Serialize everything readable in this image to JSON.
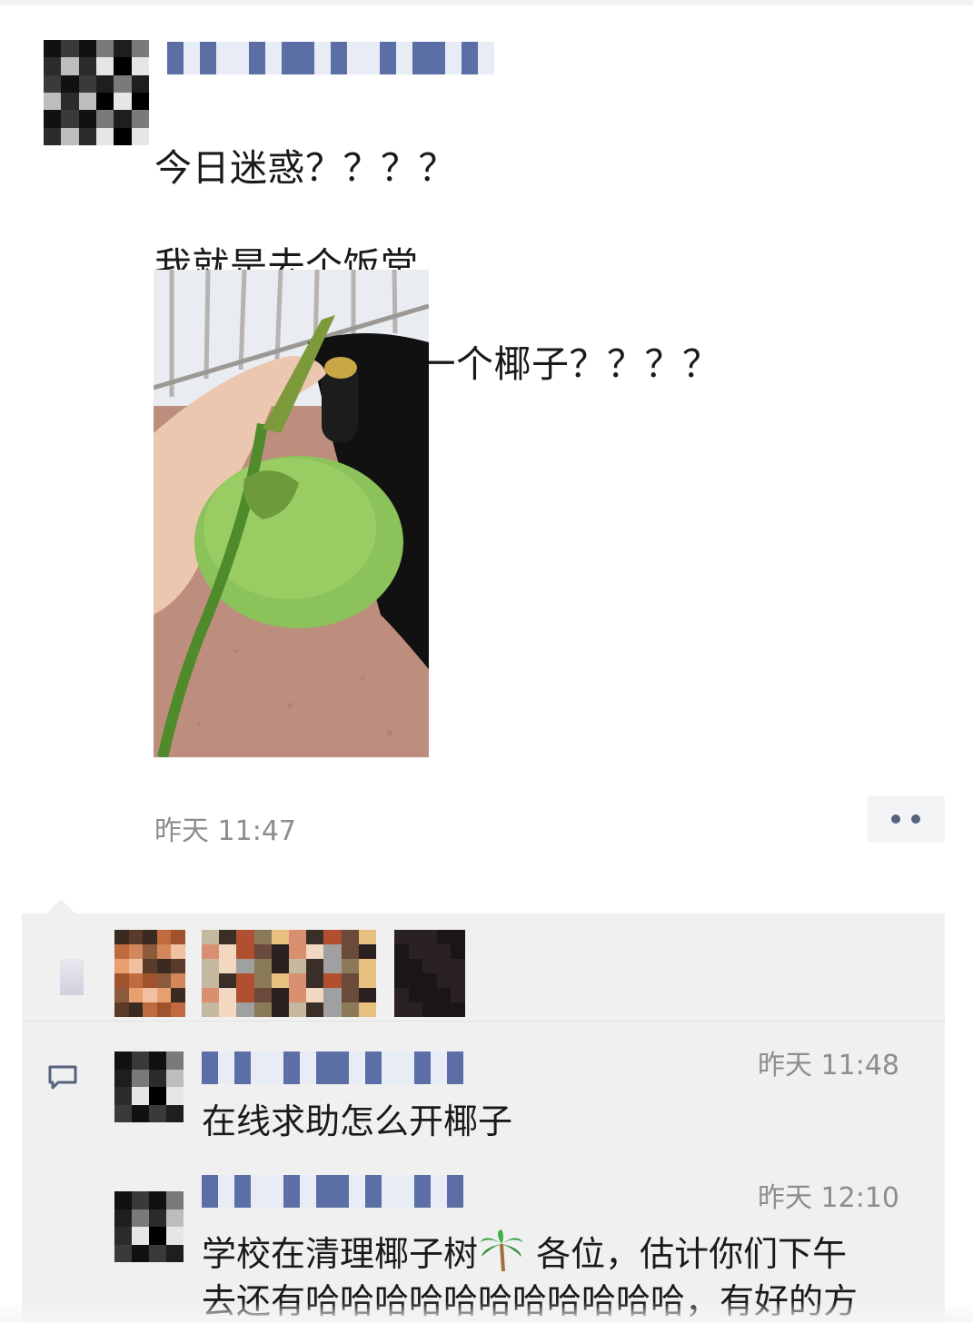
{
  "post": {
    "text_lines": [
      "今日迷惑？？？？",
      "我就是去个饭堂",
      "阿姨顺手塞给我一个椰子？？？？"
    ],
    "photo_icon": "coconut-photo",
    "timestamp": "昨天 11:47",
    "more_icon": "more-dots-icon"
  },
  "likes": {
    "icon": "heart-icon",
    "count_avatars": 3
  },
  "comments": [
    {
      "time": "昨天 11:48",
      "text": "在线求助怎么开椰子"
    },
    {
      "time": "昨天 12:10",
      "text_before": "学校在清理椰子树",
      "emoji": "palm-tree-icon",
      "text_after": " 各位，估计你们下午",
      "text_line2": "去还有哈哈哈哈哈哈哈哈哈哈哈，有好的方"
    }
  ],
  "colors": {
    "panel_bg": "#f0f0f0",
    "meta_text": "#8d8d8d",
    "link_blue": "#56627e"
  }
}
